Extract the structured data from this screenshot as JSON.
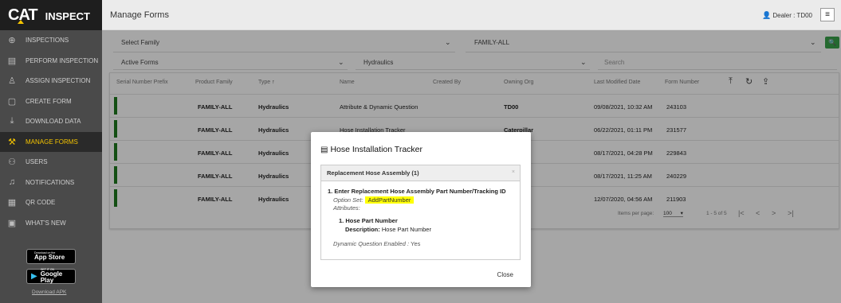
{
  "sidebar": {
    "logo_text": "CAT",
    "app_name": "INSPECT",
    "items": [
      {
        "label": "INSPECTIONS",
        "icon": "search-plus-icon"
      },
      {
        "label": "PERFORM INSPECTION",
        "icon": "clipboard-icon"
      },
      {
        "label": "ASSIGN INSPECTION",
        "icon": "assign-person-icon"
      },
      {
        "label": "CREATE FORM",
        "icon": "create-form-icon"
      },
      {
        "label": "DOWNLOAD DATA",
        "icon": "download-icon"
      },
      {
        "label": "MANAGE FORMS",
        "icon": "wrench-icon",
        "active": true
      },
      {
        "label": "USERS",
        "icon": "users-icon"
      },
      {
        "label": "NOTIFICATIONS",
        "icon": "bell-icon"
      },
      {
        "label": "QR CODE",
        "icon": "qr-code-icon"
      },
      {
        "label": "WHAT'S NEW",
        "icon": "news-icon"
      }
    ],
    "app_store": {
      "small": "Download on the",
      "big": "App Store"
    },
    "google_play": {
      "small": "GET IT ON",
      "big": "Google Play"
    },
    "apk_link": "Download APK"
  },
  "header": {
    "title": "Manage Forms",
    "dealer": "Dealer : TD00"
  },
  "filters": {
    "family_select": "Select Family",
    "family_value": "FAMILY-ALL",
    "status_select": "Active Forms",
    "type_value": "Hydraulics",
    "search_placeholder": "Search"
  },
  "table": {
    "columns": {
      "serial": "Serial Number Prefix",
      "family": "Product Family",
      "type": "Type",
      "name": "Name",
      "created": "Created By",
      "org": "Owning Org",
      "modified": "Last Modified Date",
      "number": "Form Number"
    },
    "sort_indicator": "↑",
    "rows": [
      {
        "family": "FAMILY-ALL",
        "type": "Hydraulics",
        "name": "Attribute & Dynamic Question",
        "org": "TD00",
        "modified": "09/08/2021, 10:32 AM",
        "number": "243103"
      },
      {
        "family": "FAMILY-ALL",
        "type": "Hydraulics",
        "name": "Hose Installation Tracker",
        "org": "Caterpillar",
        "modified": "06/22/2021, 01:11 PM",
        "number": "231577"
      },
      {
        "family": "FAMILY-ALL",
        "type": "Hydraulics",
        "name": "",
        "org": "pillar",
        "modified": "08/17/2021, 04:28 PM",
        "number": "229843"
      },
      {
        "family": "FAMILY-ALL",
        "type": "Hydraulics",
        "name": "",
        "org": "",
        "modified": "08/17/2021, 11:25 AM",
        "number": "240229"
      },
      {
        "family": "FAMILY-ALL",
        "type": "Hydraulics",
        "name": "",
        "org": "",
        "modified": "12/07/2020, 04:56 AM",
        "number": "211903"
      }
    ],
    "pager": {
      "items_per_page_label": "Items per page:",
      "items_per_page": "100",
      "range": "1 - 5 of 5"
    }
  },
  "modal": {
    "title": "Hose Installation Tracker",
    "panel_title": "Replacement Hose Assembly (1)",
    "question": "1. Enter Replacement Hose Assembly Part Number/Tracking ID",
    "option_set_label": "Option Set:",
    "option_set_value": "AddPartNumber",
    "attributes_label": "Attributes:",
    "attribute_title": "1. Hose Part Number",
    "attribute_desc_label": "Description:",
    "attribute_desc_value": "Hose Part Number",
    "dynamic_label": "Dynamic Question Enabled :",
    "dynamic_value": "Yes",
    "close_label": "Close"
  },
  "colors": {
    "sidebar_bg": "#4a4a4a",
    "active_accent": "#f5c400",
    "status_green": "#1e7a1e",
    "search_button": "#3aa14b",
    "highlight": "#ffff00"
  }
}
